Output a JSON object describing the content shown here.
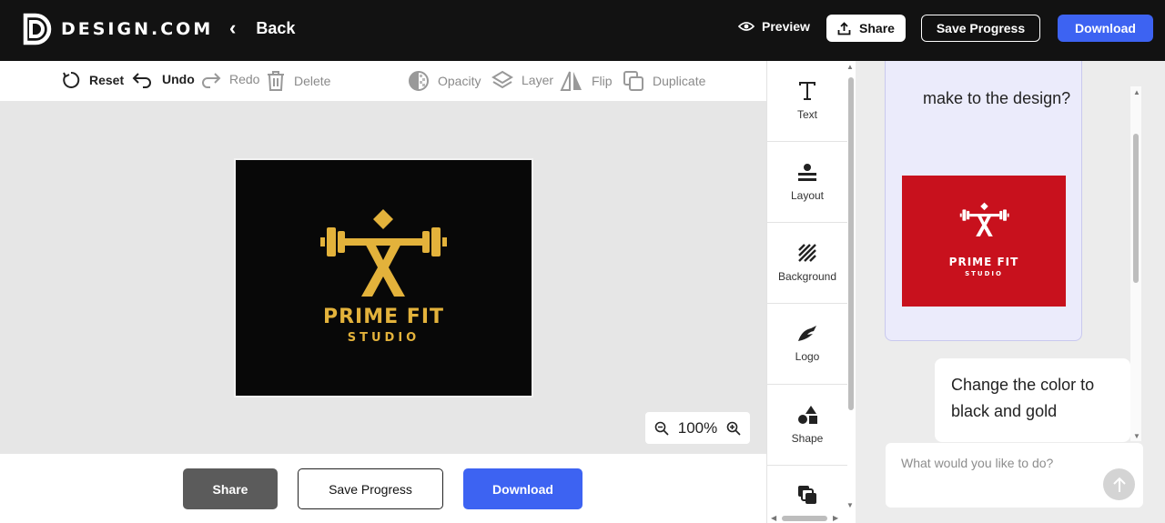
{
  "header": {
    "brand": "DESIGN.COM",
    "back_label": "Back",
    "preview_label": "Preview",
    "share_label": "Share",
    "save_label": "Save Progress",
    "download_label": "Download"
  },
  "toolbar": {
    "reset": "Reset",
    "undo": "Undo",
    "redo": "Redo",
    "delete": "Delete",
    "opacity": "Opacity",
    "layer": "Layer",
    "flip": "Flip",
    "duplicate": "Duplicate"
  },
  "canvas": {
    "logo_name": "PRIME FIT",
    "logo_tagline": "STUDIO",
    "logo_color": "#e3b23b",
    "background_color": "#080808",
    "zoom": "100%"
  },
  "bottom": {
    "share_label": "Share",
    "save_label": "Save Progress",
    "download_label": "Download"
  },
  "side_tools": [
    {
      "label": "Text",
      "icon": "text-icon"
    },
    {
      "label": "Layout",
      "icon": "layout-icon"
    },
    {
      "label": "Background",
      "icon": "background-icon"
    },
    {
      "label": "Logo",
      "icon": "logo-icon"
    },
    {
      "label": "Shape",
      "icon": "shape-icon"
    },
    {
      "label": "",
      "icon": "layers-icon"
    }
  ],
  "chat": {
    "ai_message": "make to the design?",
    "preview_name": "PRIME FIT",
    "preview_tagline": "STUDIO",
    "preview_color": "#c8111d",
    "user_message": "Change the color to black and gold",
    "input_placeholder": "What would you like to do?"
  },
  "colors": {
    "accent": "#3d63f2",
    "topbar": "#121212"
  }
}
